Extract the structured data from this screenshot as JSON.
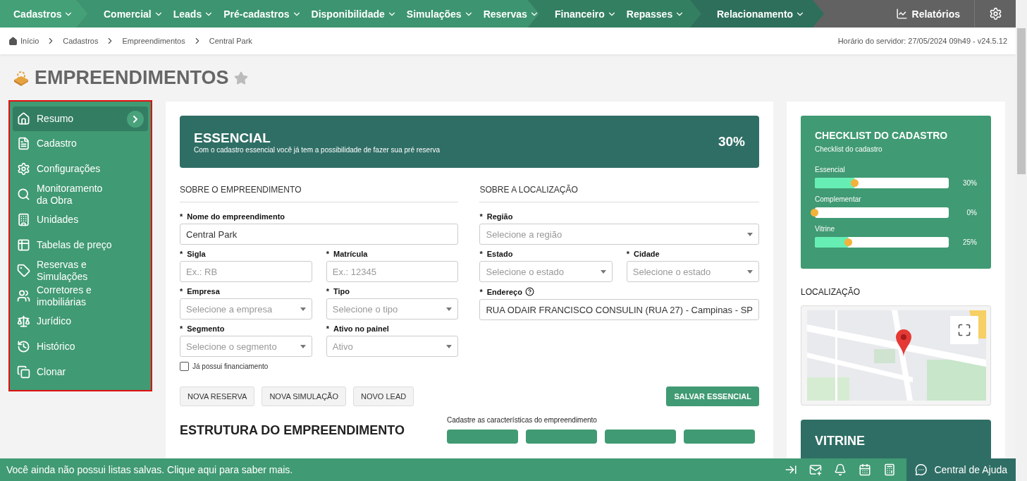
{
  "nav": {
    "segments": [
      {
        "items": [
          "Cadastros"
        ]
      },
      {
        "items": [
          "Comercial",
          "Leads",
          "Pré-cadastros",
          "Disponibilidade",
          "Simulações",
          "Reservas"
        ]
      },
      {
        "items": [
          "Financeiro",
          "Repasses"
        ]
      },
      {
        "items": [
          "Relacionamento"
        ]
      }
    ],
    "reports": "Relatórios"
  },
  "breadcrumb": [
    "Início",
    "Cadastros",
    "Empreendimentos",
    "Central Park"
  ],
  "server_time": "Horário do servidor: 27/05/2024 09h49 - v24.5.12",
  "page_title": "EMPREENDIMENTOS",
  "required_mark": "*",
  "favorite": false,
  "sidebar": {
    "items": [
      {
        "label": "Resumo",
        "selected": true
      },
      {
        "label": "Cadastro",
        "selected": false
      },
      {
        "label": "Configurações",
        "selected": false
      },
      {
        "label": "Monitoramento da Obra",
        "selected": false
      },
      {
        "label": "Unidades",
        "selected": false
      },
      {
        "label": "Tabelas de preço",
        "selected": false
      },
      {
        "label": "Reservas e Simulações",
        "selected": false
      },
      {
        "label": "Corretores e imobiliárias",
        "selected": false
      },
      {
        "label": "Jurídico",
        "selected": false
      },
      {
        "label": "Histórico",
        "selected": false
      },
      {
        "label": "Clonar",
        "selected": false
      }
    ]
  },
  "essential": {
    "title": "ESSENCIAL",
    "subtitle": "Com o cadastro essencial você já tem a possibilidade de fazer sua pré reserva",
    "percent": "30%"
  },
  "sections": [
    {
      "title": "SOBRE O EMPREENDIMENTO",
      "rows": [
        [
          {
            "required": true,
            "kind": "text",
            "label": "Nome do empreendimento",
            "value": "Central Park"
          }
        ],
        [
          {
            "required": true,
            "kind": "text",
            "label": "Sigla",
            "placeholder": "Ex.: RB"
          },
          {
            "required": true,
            "kind": "text",
            "label": "Matrícula",
            "placeholder": "Ex.: 12345"
          }
        ],
        [
          {
            "required": true,
            "kind": "select",
            "label": "Empresa",
            "placeholder": "Selecione a empresa"
          },
          {
            "required": true,
            "kind": "select",
            "label": "Tipo",
            "placeholder": "Selecione o tipo"
          }
        ],
        [
          {
            "required": true,
            "kind": "select",
            "label": "Segmento",
            "placeholder": "Selecione o segmento"
          },
          {
            "required": true,
            "kind": "select",
            "label": "Ativo no painel",
            "placeholder": "Ativo"
          }
        ]
      ]
    },
    {
      "title": "SOBRE A LOCALIZAÇÃO",
      "rows": [
        [
          {
            "required": true,
            "kind": "select",
            "label": "Região",
            "placeholder": "Selecione a região"
          }
        ],
        [
          {
            "required": true,
            "kind": "select",
            "label": "Estado",
            "placeholder": "Selecione o estado"
          },
          {
            "required": true,
            "kind": "select",
            "label": "Cidade",
            "placeholder": "Selecione o estado"
          }
        ],
        [
          {
            "required": true,
            "kind": "text",
            "label": "Endereço",
            "help": true,
            "value": "RUA ODAIR FRANCISCO CONSULIN (RUA 27) - Campinas - SP"
          }
        ]
      ]
    }
  ],
  "financing": {
    "label": "Já possui financiamento",
    "checked": false
  },
  "actions": [
    "NOVA RESERVA",
    "NOVA SIMULAÇÃO",
    "NOVO LEAD"
  ],
  "save": "SALVAR ESSENCIAL",
  "structure": {
    "title": "ESTRUTURA DO EMPREENDIMENTO",
    "hint": "Cadastre as características do empreendimento"
  },
  "checklist": {
    "title": "CHECKLIST DO CADASTRO",
    "subtitle": "Checklist do cadastro",
    "items": [
      {
        "label": "Essencial",
        "level": 0.3,
        "reading": "30%"
      },
      {
        "label": "Complementar",
        "level": 0,
        "reading": "0%"
      },
      {
        "label": "Vitrine",
        "level": 0.25,
        "reading": "25%"
      }
    ]
  },
  "location": {
    "title": "LOCALIZAÇÃO"
  },
  "vitrine": {
    "title": "VITRINE"
  },
  "bottom_bar": {
    "message": "Você ainda não possui listas salvas. Clique aqui para saber mais.",
    "help": "Central de Ajuda"
  }
}
